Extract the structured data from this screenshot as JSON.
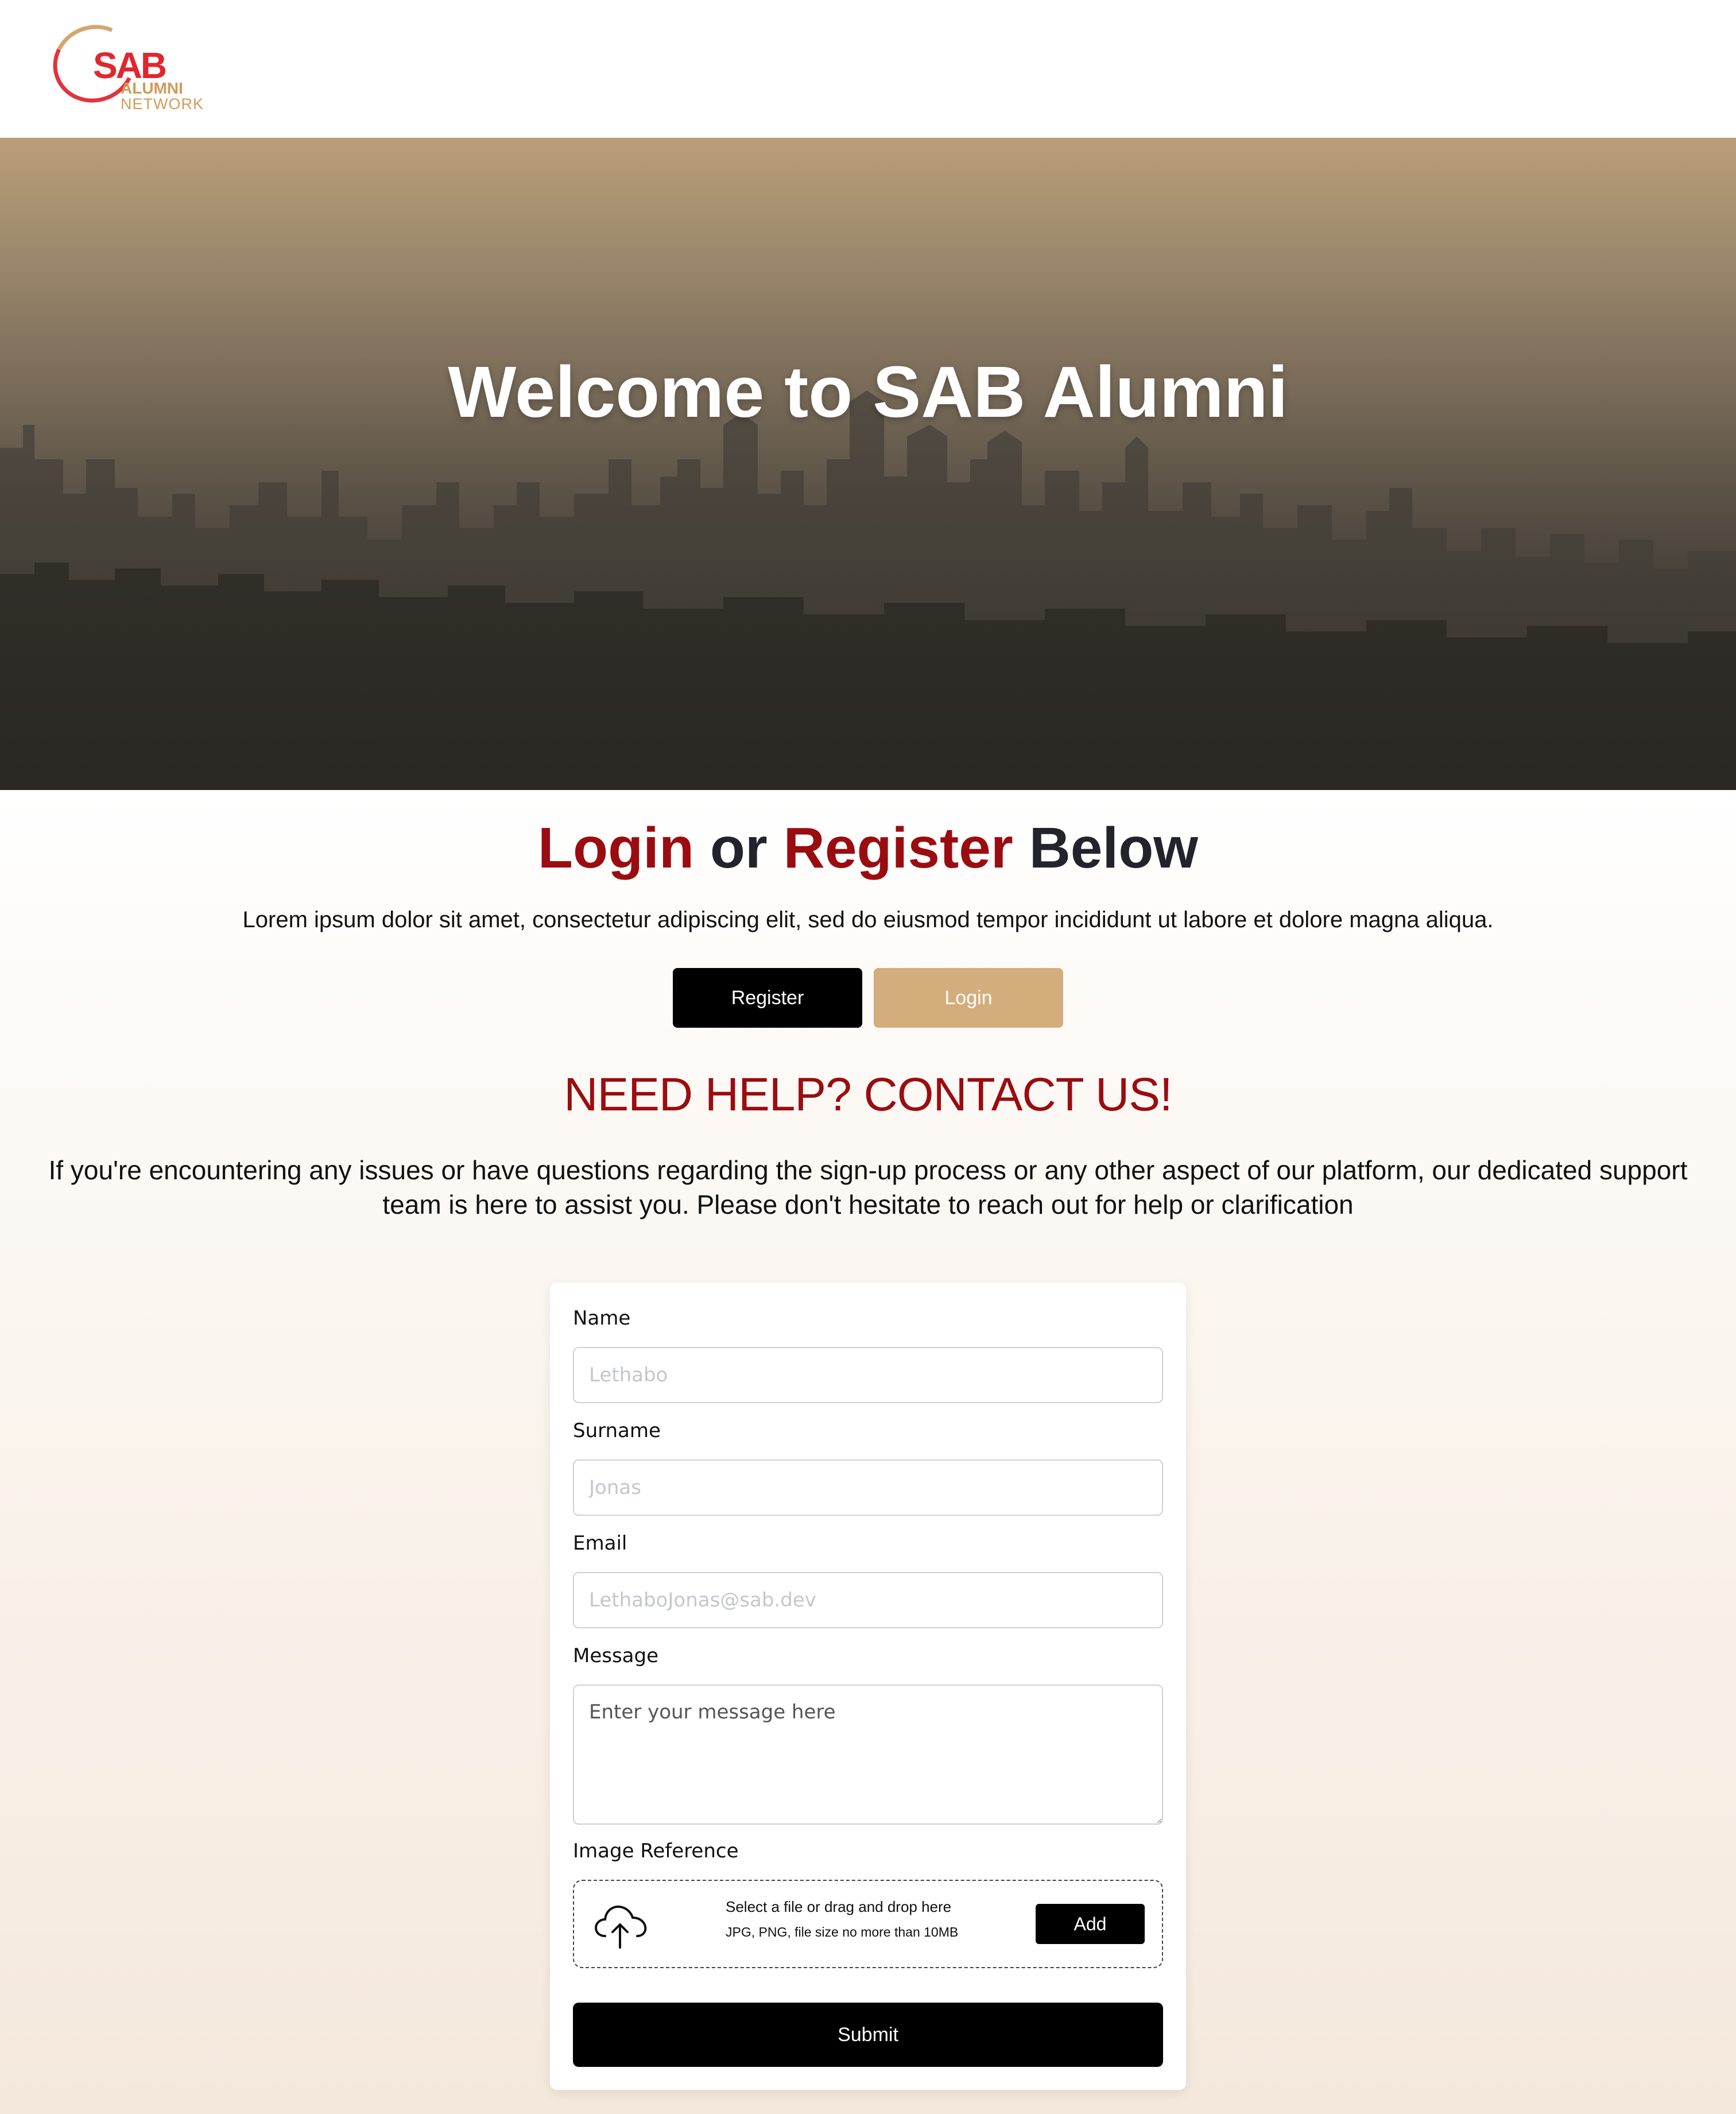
{
  "brand": {
    "logo_main": "SAB",
    "logo_sub1": "ALUMNI",
    "logo_sub2": "NETWORK",
    "primary_red": "#e1262f",
    "gold": "#d39a58"
  },
  "hero": {
    "title": "Welcome to SAB Alumni",
    "background": "hazy city skyline photo"
  },
  "auth": {
    "heading_login": "Login",
    "heading_or": "or",
    "heading_register": "Register",
    "heading_below": "Below",
    "description": "Lorem ipsum dolor sit amet, consectetur adipiscing elit, sed do eiusmod tempor incididunt ut labore et dolore magna aliqua.",
    "register_label": "Register",
    "login_label": "Login",
    "accent_color": "#9b0c10",
    "login_button_color": "#d4ad7c"
  },
  "help": {
    "heading": "NEED HELP? CONTACT US!",
    "description": "If you're encountering any issues or have questions regarding the sign-up process or any other aspect of our platform, our dedicated support team is here to assist you. Please don't hesitate to reach out for help or clarification"
  },
  "form": {
    "name_label": "Name",
    "name_placeholder": "Lethabo",
    "surname_label": "Surname",
    "surname_placeholder": "Jonas",
    "email_label": "Email",
    "email_placeholder": "LethaboJonas@sab.dev",
    "message_label": "Message",
    "message_placeholder": "Enter your message here",
    "image_label": "Image Reference",
    "upload_line1": "Select a file or drag and drop here",
    "upload_line2": "JPG, PNG, file size no more than 10MB",
    "add_label": "Add",
    "submit_label": "Submit",
    "upload_icon": "cloud-upload-icon"
  }
}
